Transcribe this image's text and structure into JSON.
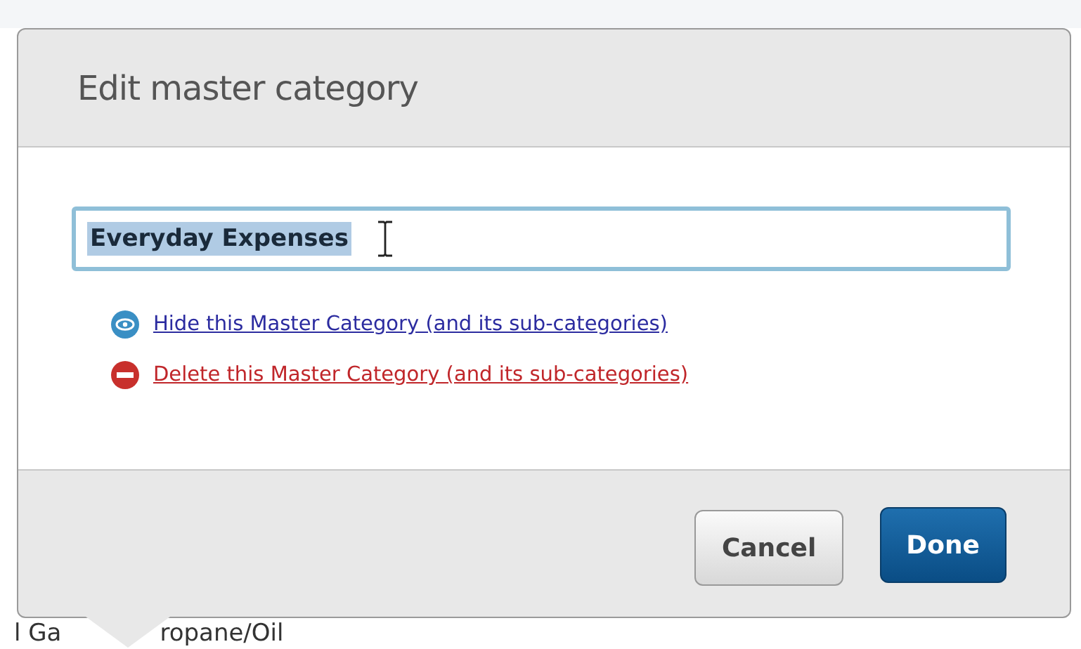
{
  "background": {
    "cell_texts": [
      "l Ga",
      "ropane/Oil"
    ]
  },
  "dialog": {
    "title": "Edit master category",
    "name_field": {
      "value": "Everyday Expenses",
      "text_selected": true
    },
    "actions": [
      {
        "kind": "hide",
        "label": "Hide this Master Category (and its sub-categories)"
      },
      {
        "kind": "delete",
        "label": "Delete this Master Category (and its sub-categories)"
      }
    ],
    "buttons": [
      {
        "label": "Cancel",
        "primary": false
      },
      {
        "label": "Done",
        "primary": true
      }
    ]
  }
}
